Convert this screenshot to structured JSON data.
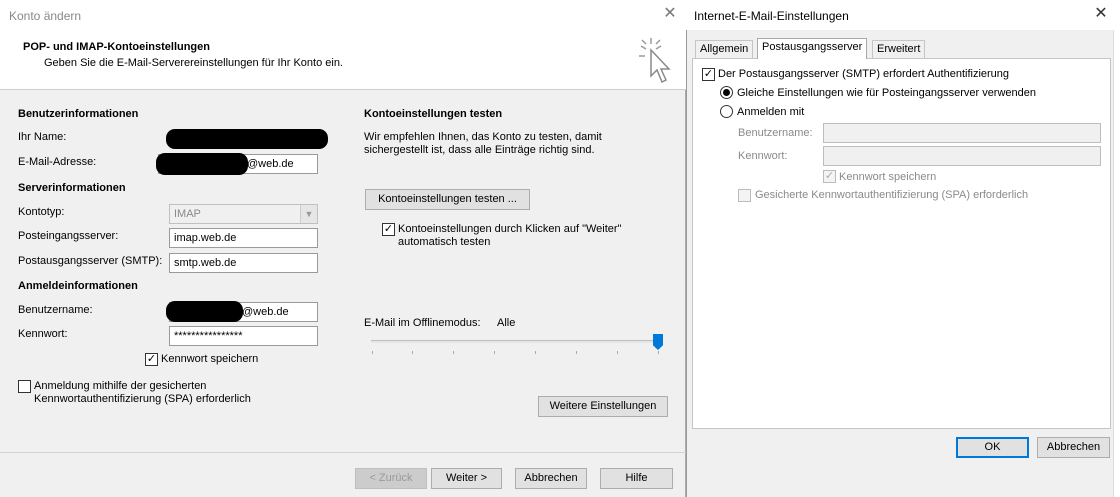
{
  "left": {
    "title": "Konto ändern",
    "close_glyph": "✕",
    "header_title": "POP- und IMAP-Kontoeinstellungen",
    "header_sub": "Geben Sie die E-Mail-Serverereinstellungen für Ihr Konto ein.",
    "header_icon": "cursor-click-icon",
    "user_info": {
      "heading": "Benutzerinformationen",
      "name_label": "Ihr Name:",
      "email_label": "E-Mail-Adresse:",
      "email_suffix": "@web.de"
    },
    "server_info": {
      "heading": "Serverinformationen",
      "type_label": "Kontotyp:",
      "type_value": "IMAP",
      "incoming_label": "Posteingangsserver:",
      "incoming_value": "imap.web.de",
      "outgoing_label": "Postausgangsserver (SMTP):",
      "outgoing_value": "smtp.web.de"
    },
    "login_info": {
      "heading": "Anmeldeinformationen",
      "username_label": "Benutzername:",
      "username_suffix": "@web.de",
      "password_label": "Kennwort:",
      "password_value": "****************",
      "save_password_label": "Kennwort speichern",
      "save_password_checked": true,
      "spa_label_1": "Anmeldung mithilfe der gesicherten",
      "spa_label_2": "Kennwortauthentifizierung (SPA) erforderlich",
      "spa_checked": false
    },
    "test": {
      "heading": "Kontoeinstellungen testen",
      "desc_1": "Wir empfehlen Ihnen, das Konto zu testen, damit",
      "desc_2": "sichergestellt ist, dass alle Einträge richtig sind.",
      "button": "Kontoeinstellungen testen ...",
      "auto_label_1": "Kontoeinstellungen durch Klicken auf \"Weiter\"",
      "auto_label_2": "automatisch testen",
      "auto_checked": true
    },
    "offline": {
      "label": "E-Mail im Offlinemodus:",
      "value": "Alle",
      "slider_level_fraction": 1.0
    },
    "more_settings_button": "Weitere Einstellungen",
    "footer": {
      "back": "< Zurück",
      "next": "Weiter >",
      "cancel": "Abbrechen",
      "help": "Hilfe"
    }
  },
  "right": {
    "title": "Internet-E-Mail-Einstellungen",
    "close_glyph": "✕",
    "tabs": [
      "Allgemein",
      "Postausgangsserver",
      "Erweitert"
    ],
    "active_tab": "Postausgangsserver",
    "smtp_auth_label": "Der Postausgangsserver (SMTP) erfordert Authentifizierung",
    "smtp_auth_checked": true,
    "same_settings_label": "Gleiche Einstellungen wie für Posteingangsserver verwenden",
    "login_with_label": "Anmelden mit",
    "username_label": "Benutzername:",
    "password_label": "Kennwort:",
    "save_password_label": "Kennwort speichern",
    "spa_label": "Gesicherte Kennwortauthentifizierung (SPA) erforderlich",
    "ok": "OK",
    "cancel": "Abbrechen"
  },
  "colors": {
    "accent": "#0078d7",
    "redaction": "#000000"
  }
}
